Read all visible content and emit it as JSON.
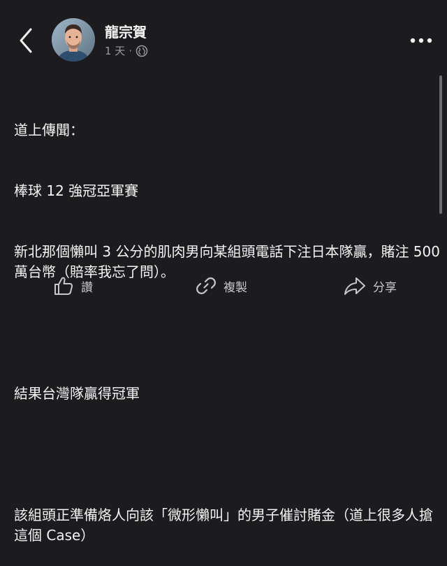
{
  "header": {
    "author_name": "龍宗賀",
    "time": "1 天",
    "separator": "·",
    "privacy_icon": "globe-icon",
    "back_icon": "chevron-left-icon",
    "more_icon": "more-dots-icon"
  },
  "post": {
    "lines": [
      "道上傳聞：",
      "棒球 12 強冠亞軍賽",
      "新北那個懶叫 3 公分的肌肉男向某組頭電話下注日本隊贏，賭注 500 萬台幣（賠率我忘了問）。",
      "",
      "結果台灣隊贏得冠軍",
      "",
      "該組頭正準備烙人向該「微形懶叫」的男子催討賭金（道上很多人搶這個 Case）"
    ]
  },
  "actions": {
    "like_label": "讚",
    "like_icon": "thumbs-up-icon",
    "copy_label": "複製",
    "copy_icon": "link-icon",
    "share_label": "分享",
    "share_icon": "share-icon"
  }
}
